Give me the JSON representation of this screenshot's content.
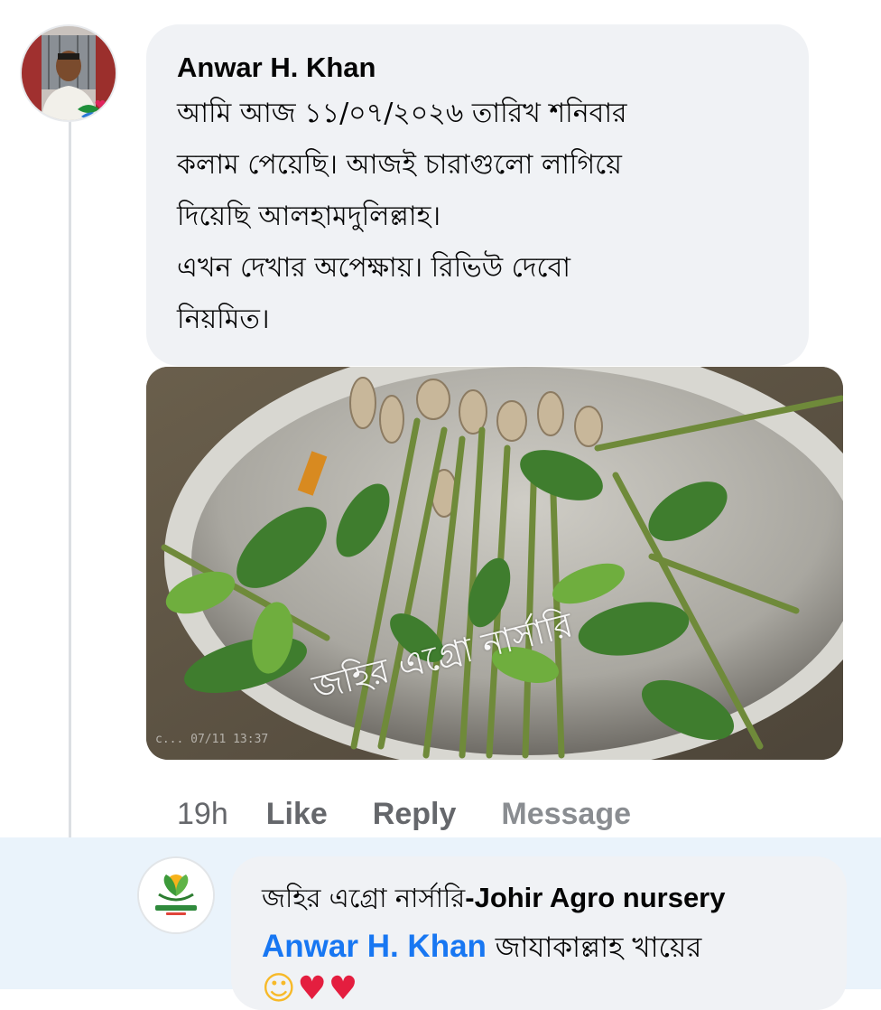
{
  "comment": {
    "author": "Anwar H. Khan",
    "text": "আমি আজ ১১/০৭/২০২৬ তারিখ শনিবার\nকলাম পেয়েছি।  আজই চারাগুলো লাগিয়ে\nদিয়েছি আলহামদুলিল্লাহ।\nএখন দেখার অপেক্ষায়।  রিভিউ দেবো\nনিয়মিত।",
    "photo": {
      "watermark": "জহির এগ্রো নার্সারি",
      "stamp": "c... 07/11 13:37"
    },
    "actions": {
      "time": "19h",
      "like": "Like",
      "reply": "Reply",
      "message": "Message"
    }
  },
  "reply": {
    "author_bn": "জহির এগ্রো নার্সারি",
    "author_en": "-Johir  Agro  nursery",
    "mention": "Anwar H. Khan",
    "text": " জাযাকাল্লাহ খায়ের",
    "emoji": [
      "smile-emoji",
      "red-heart-emoji",
      "red-heart-emoji"
    ],
    "logo_text": "জহির এগ্রো নার্সারি"
  },
  "colors": {
    "bubble": "#f0f2f5",
    "reply_section_bg": "#eaf3fb",
    "mention": "#1877f2",
    "meta": "#65676b"
  }
}
